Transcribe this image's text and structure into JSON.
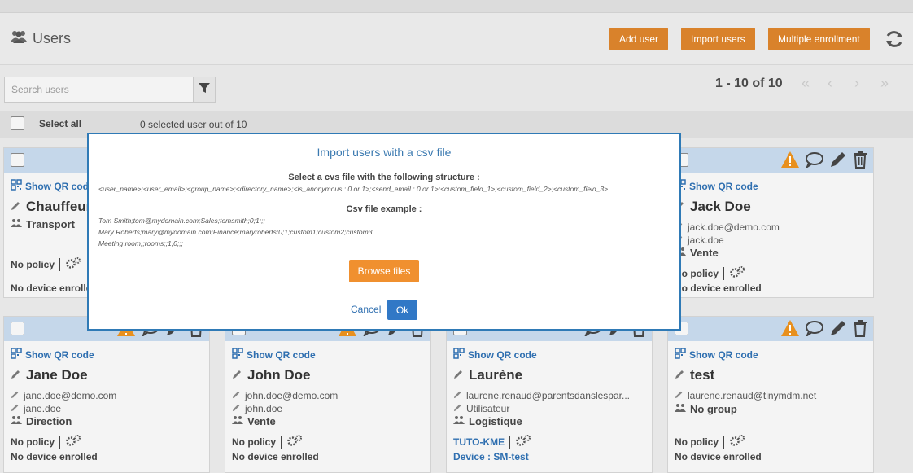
{
  "header": {
    "title": "Users",
    "add_user": "Add user",
    "import_users": "Import users",
    "multiple_enrollment": "Multiple enrollment"
  },
  "search": {
    "placeholder": "Search users"
  },
  "pagination": {
    "label": "1 - 10 of 10"
  },
  "selection": {
    "select_all": "Select all",
    "count_text": "0 selected user out of 10"
  },
  "colors": {
    "accent": "#d9822b",
    "card_header": "#c5d7ea",
    "link": "#2f6fb0",
    "warning": "#e8901e"
  },
  "cards_top": [
    {
      "qr": "Show QR code",
      "name": "Chauffeur",
      "group": "Transport",
      "policy": "No policy",
      "device": "No device enrolled"
    },
    {
      "qr": "Show QR code",
      "name": "Jack Doe",
      "email": "jack.doe@demo.com",
      "username": "jack.doe",
      "group": "Vente",
      "policy": "No policy",
      "device": "No device enrolled"
    }
  ],
  "cards_bottom": [
    {
      "qr": "Show QR code",
      "name": "Jane Doe",
      "email": "jane.doe@demo.com",
      "username": "jane.doe",
      "group": "Direction",
      "policy": "No policy",
      "device": "No device enrolled"
    },
    {
      "qr": "Show QR code",
      "name": "John Doe",
      "email": "john.doe@demo.com",
      "username": "john.doe",
      "group": "Vente",
      "policy": "No policy",
      "device": "No device enrolled"
    },
    {
      "qr": "Show QR code",
      "name": "Laurène",
      "email": "laurene.renaud@parentsdanslespar...",
      "username": "Utilisateur",
      "group": "Logistique",
      "policy": "TUTO-KME",
      "device": "Device : SM-test"
    },
    {
      "qr": "Show QR code",
      "name": "test",
      "email": "laurene.renaud@tinymdm.net",
      "group": "No group",
      "policy": "No policy",
      "device": "No device enrolled"
    }
  ],
  "modal": {
    "title": "Import users with a csv file",
    "structure_heading": "Select a cvs file with the following structure :",
    "structure": "<user_name>;<user_email>;<group_name>;<directory_name>;<is_anonymous : 0 or 1>;<send_email : 0 or 1>;<custom_field_1>;<custom_field_2>;<custom_field_3>",
    "example_heading": "Csv file example :",
    "example_lines": [
      "Tom Smith;tom@mydomain.com;Sales;tomsmith;0;1;;;",
      "Mary Roberts;mary@mydomain.com;Finance;maryroberts;0;1;custom1;custom2;custom3",
      "Meeting room;;rooms;;1;0;;;"
    ],
    "browse": "Browse files",
    "cancel": "Cancel",
    "ok": "Ok"
  }
}
